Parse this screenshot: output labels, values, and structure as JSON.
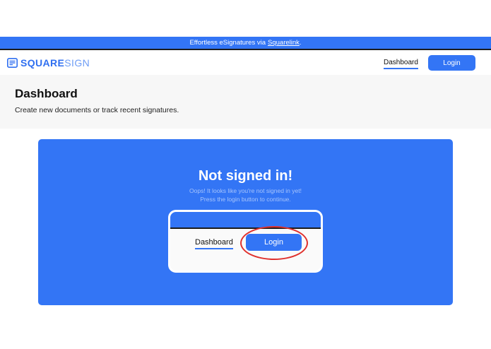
{
  "banner": {
    "text": "Effortless eSignatures via",
    "link": "Squarelink",
    "end": "."
  },
  "nav": {
    "logo_part1": "SQUARE",
    "logo_part2": "SIGN",
    "dashboard": "Dashboard",
    "login": "Login"
  },
  "header": {
    "title": "Dashboard",
    "subtitle": "Create new documents or track recent signatures."
  },
  "card": {
    "title": "Not signed in!",
    "line1": "Oops! It looks like you're not signed in yet!",
    "line2": "Press the login button to continue."
  },
  "preview": {
    "dashboard": "Dashboard",
    "login": "Login"
  },
  "colors": {
    "primary": "#3375f5",
    "highlight": "#e0312d"
  },
  "icons": {
    "logo": "document-pen-icon"
  }
}
